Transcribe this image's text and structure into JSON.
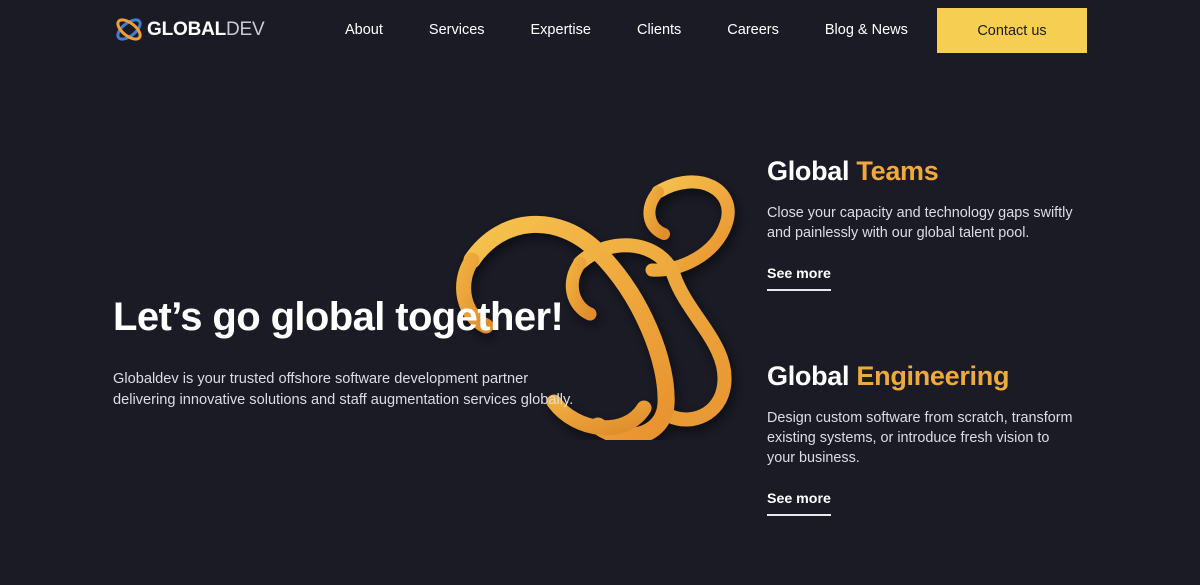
{
  "header": {
    "logo": {
      "icon": "orbit-atom-icon",
      "text_bold": "GLOBAL",
      "text_light": "DEV",
      "colors": {
        "arc_blue": "#3f7fd0",
        "arc_orange": "#eda03a"
      }
    },
    "nav_items": [
      {
        "label": "About"
      },
      {
        "label": "Services"
      },
      {
        "label": "Expertise"
      },
      {
        "label": "Clients"
      },
      {
        "label": "Careers"
      },
      {
        "label": "Blog & News"
      }
    ],
    "contact_button": {
      "label": "Contact us",
      "bg": "#f5ce52",
      "fg": "#1b1b26"
    }
  },
  "hero": {
    "title": "Let’s go global together!",
    "subtitle": "Globaldev is your trusted offshore software development partner delivering innovative solutions and staff augmentation services globally.",
    "artwork": {
      "name": "amber-spiral-ribbon-graphic",
      "color": "#efa83c"
    }
  },
  "cards": [
    {
      "title_white": "Global",
      "title_accent": "Teams",
      "description": "Close your capacity and technology gaps swiftly and painlessly with our global talent pool.",
      "link_label": "See more"
    },
    {
      "title_white": "Global",
      "title_accent": "Engineering",
      "description": "Design custom software from scratch, transform existing systems, or introduce fresh vision to your business.",
      "link_label": "See more"
    }
  ],
  "theme": {
    "background": "#1b1b26",
    "accent": "#f0a93b",
    "button": "#f5ce52",
    "text": "#ffffff",
    "muted_text": "#dcdde3"
  }
}
